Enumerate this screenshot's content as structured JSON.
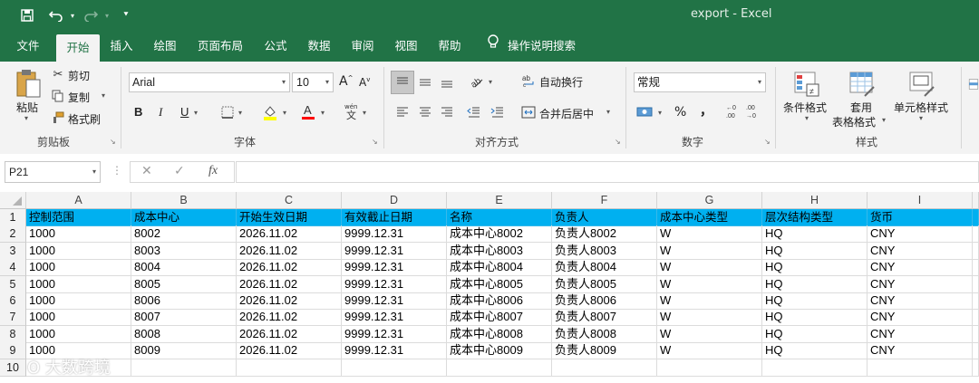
{
  "window": {
    "title": "export  -  Excel"
  },
  "tabs": [
    "文件",
    "开始",
    "插入",
    "绘图",
    "页面布局",
    "公式",
    "数据",
    "审阅",
    "视图",
    "帮助"
  ],
  "tell_me": "操作说明搜索",
  "ribbon": {
    "clipboard": {
      "paste": "粘贴",
      "cut": "剪切",
      "copy": "复制",
      "format_painter": "格式刷",
      "label": "剪贴板"
    },
    "font": {
      "name": "Arial",
      "size": "10",
      "bold": "B",
      "italic": "I",
      "underline": "U",
      "label": "字体"
    },
    "alignment": {
      "wrap": "自动换行",
      "merge": "合并后居中",
      "label": "对齐方式"
    },
    "number": {
      "format": "常规",
      "percent": "%",
      "comma": "，",
      "label": "数字"
    },
    "styles": {
      "conditional": "条件格式",
      "table_top": "套用",
      "table_bottom": "表格格式",
      "cell_styles": "单元格样式",
      "label": "样式"
    }
  },
  "formula_bar": {
    "name_box": "P21",
    "fx": "fx",
    "formula": ""
  },
  "columns": [
    "A",
    "B",
    "C",
    "D",
    "E",
    "F",
    "G",
    "H",
    "I"
  ],
  "rows": [
    "1",
    "2",
    "3",
    "4",
    "5",
    "6",
    "7",
    "8",
    "9",
    "10"
  ],
  "header_row": [
    "控制范围",
    "成本中心",
    "开始生效日期",
    "有效截止日期",
    "名称",
    "负责人",
    "成本中心类型",
    "层次结构类型",
    "货币"
  ],
  "data_rows": [
    [
      "1000",
      "8002",
      "2026.11.02",
      "9999.12.31",
      "成本中心8002",
      "负责人8002",
      "W",
      "HQ",
      "CNY"
    ],
    [
      "1000",
      "8003",
      "2026.11.02",
      "9999.12.31",
      "成本中心8003",
      "负责人8003",
      "W",
      "HQ",
      "CNY"
    ],
    [
      "1000",
      "8004",
      "2026.11.02",
      "9999.12.31",
      "成本中心8004",
      "负责人8004",
      "W",
      "HQ",
      "CNY"
    ],
    [
      "1000",
      "8005",
      "2026.11.02",
      "9999.12.31",
      "成本中心8005",
      "负责人8005",
      "W",
      "HQ",
      "CNY"
    ],
    [
      "1000",
      "8006",
      "2026.11.02",
      "9999.12.31",
      "成本中心8006",
      "负责人8006",
      "W",
      "HQ",
      "CNY"
    ],
    [
      "1000",
      "8007",
      "2026.11.02",
      "9999.12.31",
      "成本中心8007",
      "负责人8007",
      "W",
      "HQ",
      "CNY"
    ],
    [
      "1000",
      "8008",
      "2026.11.02",
      "9999.12.31",
      "成本中心8008",
      "负责人8008",
      "W",
      "HQ",
      "CNY"
    ],
    [
      "1000",
      "8009",
      "2026.11.02",
      "9999.12.31",
      "成本中心8009",
      "负责人8009",
      "W",
      "HQ",
      "CNY"
    ]
  ],
  "watermark": "大数跨境",
  "colors": {
    "excel_green": "#217346",
    "header_fill": "#00b0f0"
  }
}
